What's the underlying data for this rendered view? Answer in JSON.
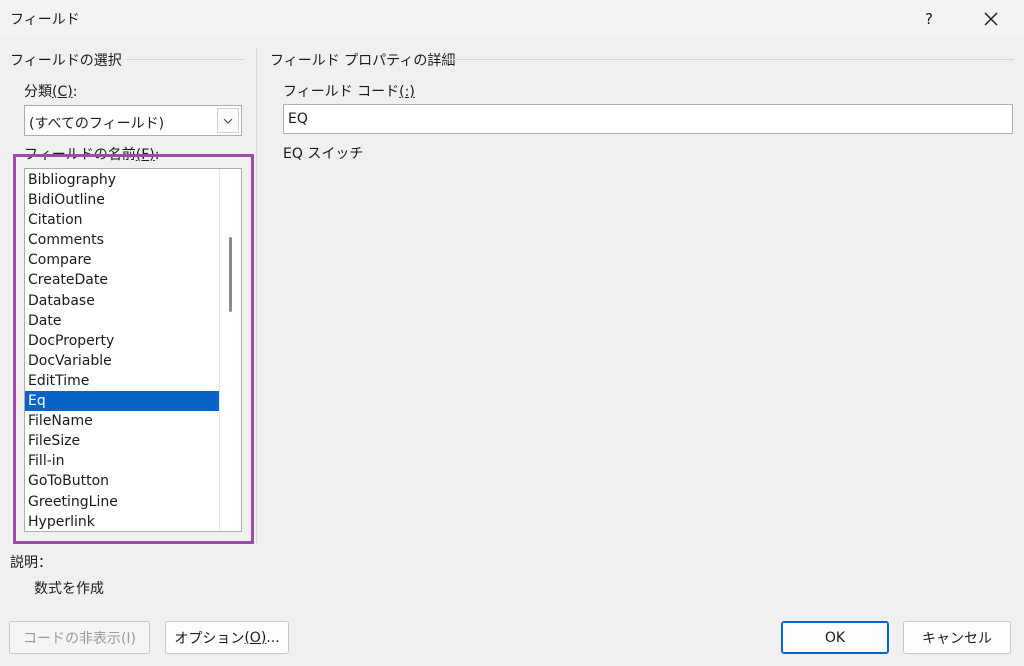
{
  "window": {
    "title": "フィールド",
    "help_label": "?"
  },
  "left_group": {
    "title": "フィールドの選択",
    "category_label": "分類",
    "category_mnemonic": "(C)",
    "category_suffix": ":",
    "category_value": "(すべてのフィールド)",
    "names_label": "フィールドの名前",
    "names_mnemonic": "(F)",
    "names_suffix": ":",
    "field_names": [
      "Bibliography",
      "BidiOutline",
      "Citation",
      "Comments",
      "Compare",
      "CreateDate",
      "Database",
      "Date",
      "DocProperty",
      "DocVariable",
      "EditTime",
      "Eq",
      "FileName",
      "FileSize",
      "Fill-in",
      "GoToButton",
      "GreetingLine",
      "Hyperlink"
    ],
    "selected_index": 11
  },
  "right_group": {
    "title": "フィールド プロパティの詳細",
    "code_label": "フィールド コード",
    "code_mnemonic": "(:)",
    "code_value": "EQ",
    "switch_label": "EQ スイッチ"
  },
  "description": {
    "label": "説明：",
    "text": "数式を作成"
  },
  "buttons": {
    "hide_codes": "コードの非表示(I)",
    "options_prefix": "オプション",
    "options_mnemonic": "(O)",
    "options_suffix": "...",
    "ok": "OK",
    "cancel": "キャンセル"
  },
  "colors": {
    "selection": "#0a64c8",
    "highlight_frame": "#9b4ca6"
  }
}
